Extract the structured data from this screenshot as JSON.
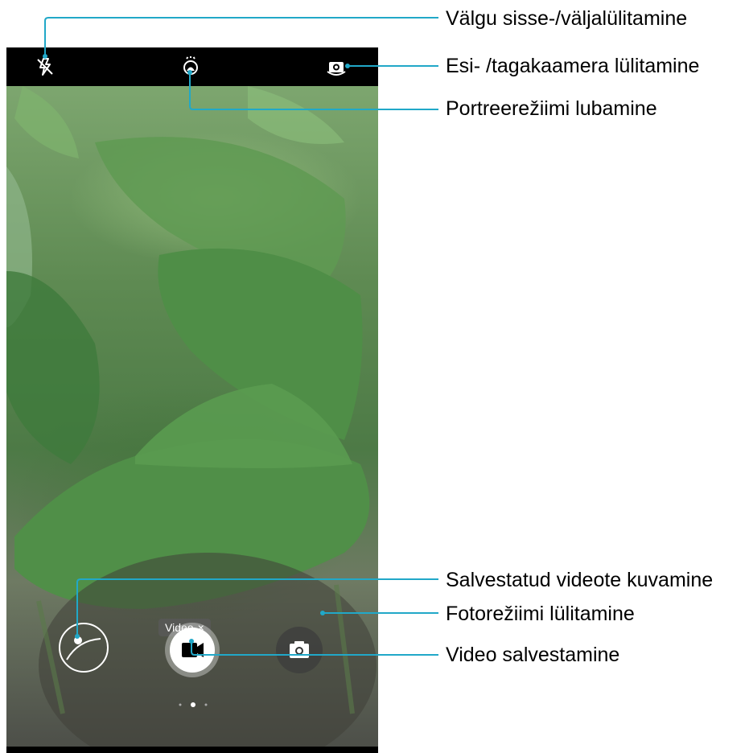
{
  "camera": {
    "mode_chip": {
      "label": "Video",
      "close_glyph": "×"
    },
    "top_icons": [
      "flash-off-icon",
      "portrait-icon",
      "switch-camera-icon"
    ],
    "bottom_controls": [
      "gallery-thumbnail",
      "record-video-button",
      "photo-mode-button"
    ],
    "mode_page_indicator": {
      "count": 3,
      "active_index": 1
    }
  },
  "annotations": {
    "flash_toggle": "Välgu sisse-/väljalülitamine",
    "camera_switch": "Esi- /tagakaamera lülitamine",
    "portrait_mode": "Portreerežiimi lubamine",
    "view_saved_videos": "Salvestatud videote kuvamine",
    "photo_mode": "Fotorežiimi lülitamine",
    "record_video": "Video salvestamine"
  },
  "colors": {
    "leader_line": "#21a8c8",
    "record_dot": "#000000",
    "chip_background": "#5a5a5a"
  }
}
